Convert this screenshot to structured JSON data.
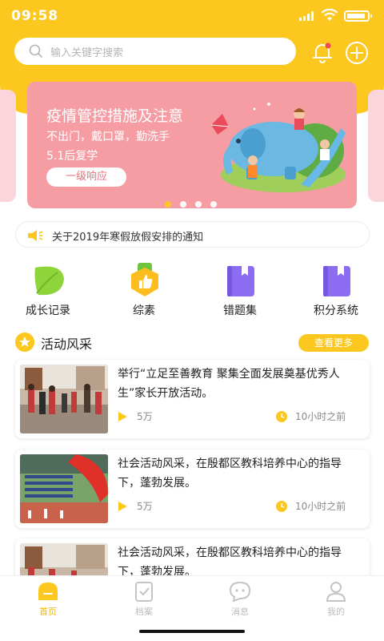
{
  "status": {
    "time": "09:58"
  },
  "search": {
    "placeholder": "输入关键字搜索"
  },
  "icons": {
    "bell": "bell-icon",
    "plus": "plus-circle-icon",
    "search": "search-icon"
  },
  "banner": {
    "title": "疫情管控措施及注意",
    "line1": "不出门，戴口罩，勤洗手",
    "line2": "5.1后复学",
    "button": "一级响应",
    "page_count": 4,
    "active_page": 1
  },
  "notice": {
    "text": "关于2019年寒假放假安排的通知"
  },
  "quick_links": [
    {
      "label": "成长记录",
      "icon": "leaf-icon"
    },
    {
      "label": "综素",
      "icon": "thumbs-up-badge-icon"
    },
    {
      "label": "错题集",
      "icon": "book-bookmark-icon"
    },
    {
      "label": "积分系统",
      "icon": "book-bookmark-icon"
    }
  ],
  "section": {
    "title": "活动风采",
    "more": "查看更多"
  },
  "articles": [
    {
      "title": "举行“立足至善教育 聚集全面发展奠基优秀人生”家长开放活动。",
      "plays": "5万",
      "time": "10小时之前"
    },
    {
      "title": "社会活动风采，在殷都区教科培养中心的指导下，蓬勃发展。",
      "plays": "5万",
      "time": "10小时之前"
    },
    {
      "title": "社会活动风采，在殷都区教科培养中心的指导下，蓬勃发展。",
      "plays": "",
      "time": ""
    }
  ],
  "tabs": [
    {
      "label": "首页",
      "active": true
    },
    {
      "label": "档案",
      "active": false
    },
    {
      "label": "消息",
      "active": false
    },
    {
      "label": "我的",
      "active": false
    }
  ],
  "colors": {
    "accent": "#fcc81f",
    "banner": "#f69da4",
    "inactive": "#bcbcbc"
  }
}
